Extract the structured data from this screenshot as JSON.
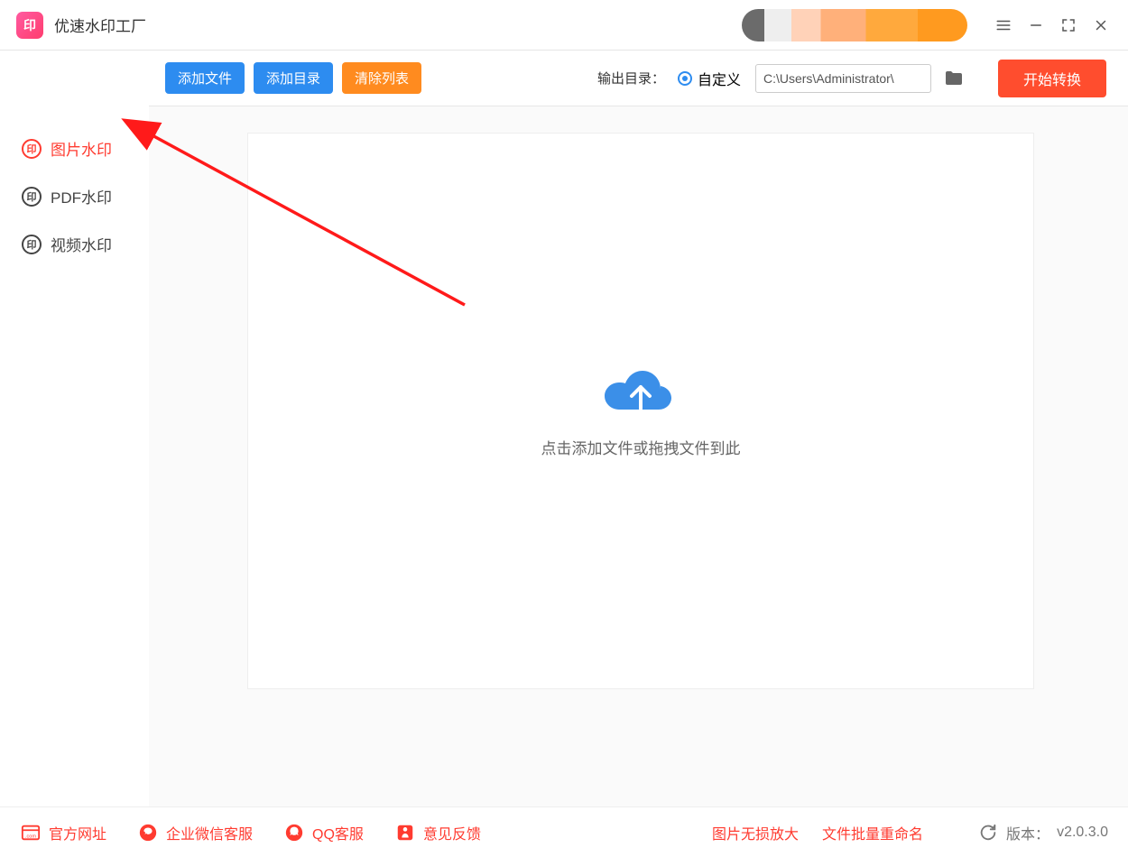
{
  "app": {
    "title": "优速水印工厂",
    "logo_glyph": "印"
  },
  "sidebar": {
    "items": [
      {
        "label": "图片水印",
        "active": true
      },
      {
        "label": "PDF水印",
        "active": false
      },
      {
        "label": "视频水印",
        "active": false
      }
    ],
    "icon_glyph": "印"
  },
  "toolbar": {
    "add_file": "添加文件",
    "add_dir": "添加目录",
    "clear": "清除列表",
    "output_label": "输出目录：",
    "custom_label": "自定义",
    "path_value": "C:\\Users\\Administrator\\",
    "start": "开始转换"
  },
  "drop": {
    "hint": "点击添加文件或拖拽文件到此"
  },
  "footer": {
    "site": "官方网址",
    "wecom": "企业微信客服",
    "qq": "QQ客服",
    "feedback": "意见反馈",
    "link_enlarge": "图片无损放大",
    "link_rename": "文件批量重命名",
    "version_label": "版本：",
    "version": "v2.0.3.0"
  }
}
